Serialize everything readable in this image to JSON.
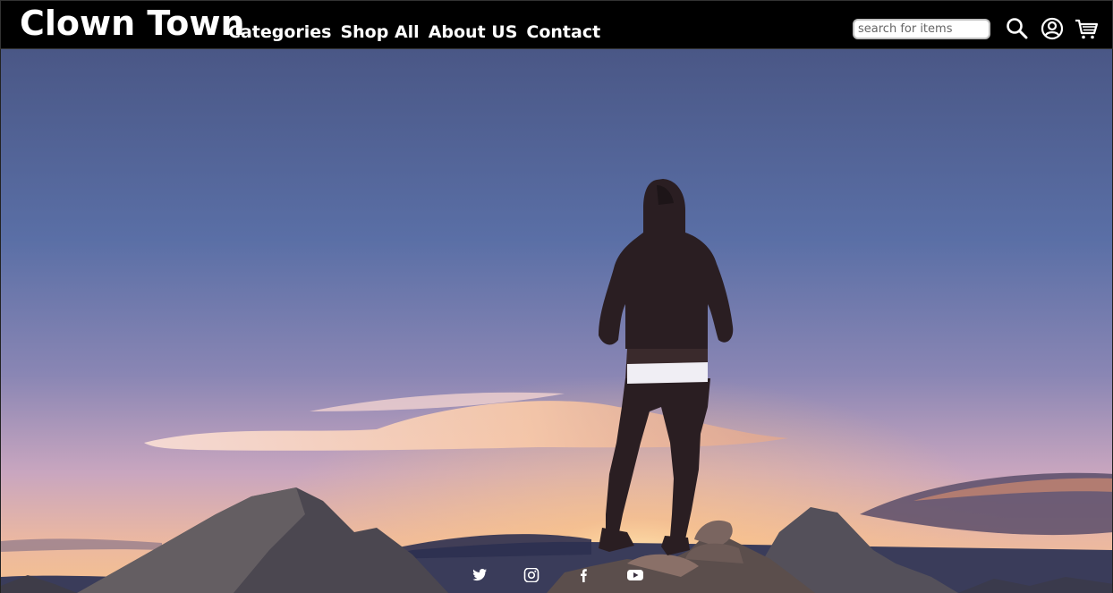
{
  "brand": {
    "name": "Clown Town"
  },
  "nav": {
    "items": [
      {
        "label": "Categories"
      },
      {
        "label": "Shop All"
      },
      {
        "label": "About US"
      },
      {
        "label": "Contact"
      }
    ]
  },
  "search": {
    "placeholder": "search for items",
    "value": ""
  },
  "header_icons": [
    "search-icon",
    "account-icon",
    "cart-icon"
  ],
  "hero": {
    "image": "person standing on mountain peak at sunset"
  },
  "social": [
    "twitter-icon",
    "instagram-icon",
    "facebook-icon",
    "youtube-icon"
  ],
  "colors": {
    "nav_bg": "#000000",
    "text": "#ffffff",
    "sky_top": "#4a5a86",
    "sky_glow": "#f2b58a"
  }
}
